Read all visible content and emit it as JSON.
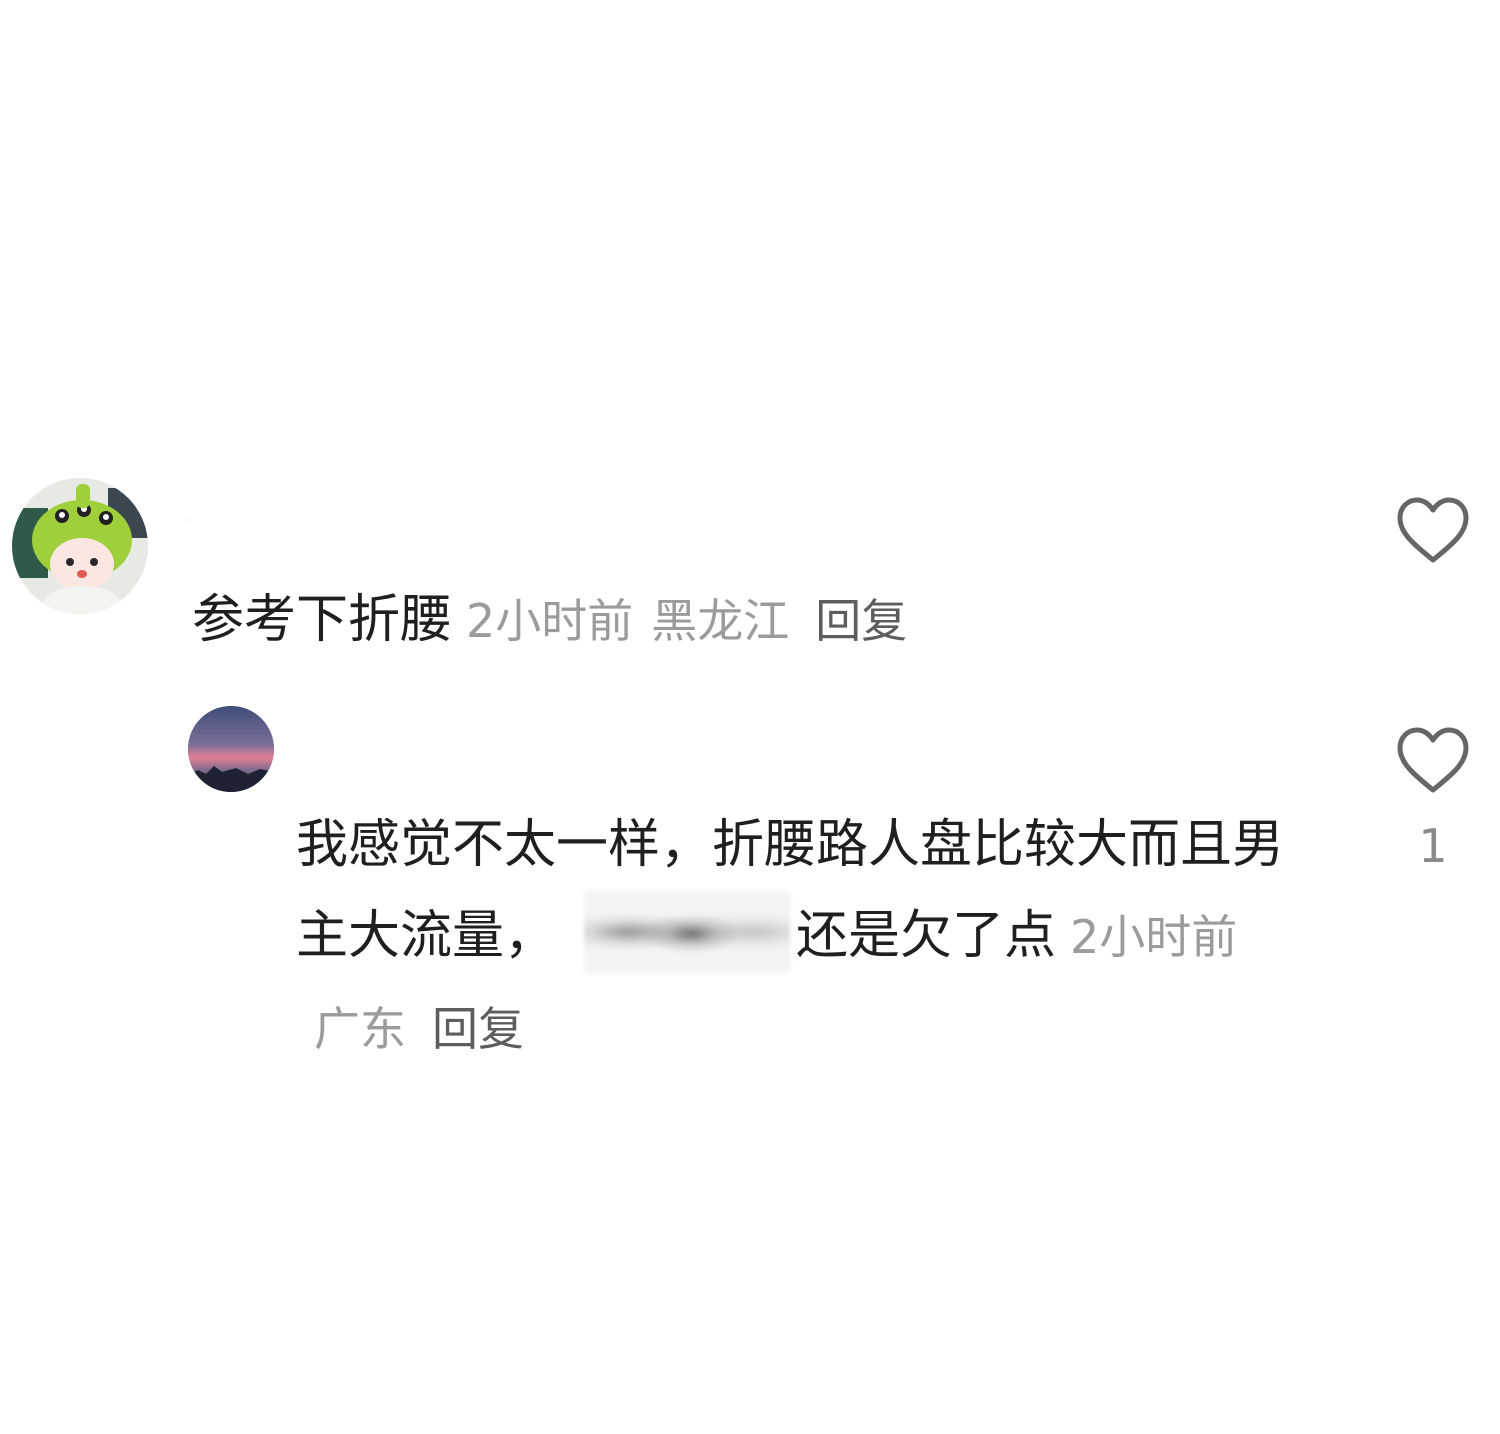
{
  "comments": [
    {
      "username": "·",
      "text": "参考下折腰",
      "time": "2小时前",
      "location": "黑龙江",
      "reply_label": "回复",
      "likes": ""
    },
    {
      "text_before_blur": "我感觉不太一样，折腰路人盘比较大而且男主大流量，",
      "text_after_blur": "还是欠了点",
      "time": "2小时前",
      "location": "广东",
      "reply_label": "回复",
      "likes": "1"
    }
  ],
  "colors": {
    "text": "#1f1f1f",
    "meta": "#9b9b9b",
    "reply": "#5d5d5d",
    "heart_outline": "#666666"
  },
  "icons": {
    "like": "heart-outline-icon"
  }
}
